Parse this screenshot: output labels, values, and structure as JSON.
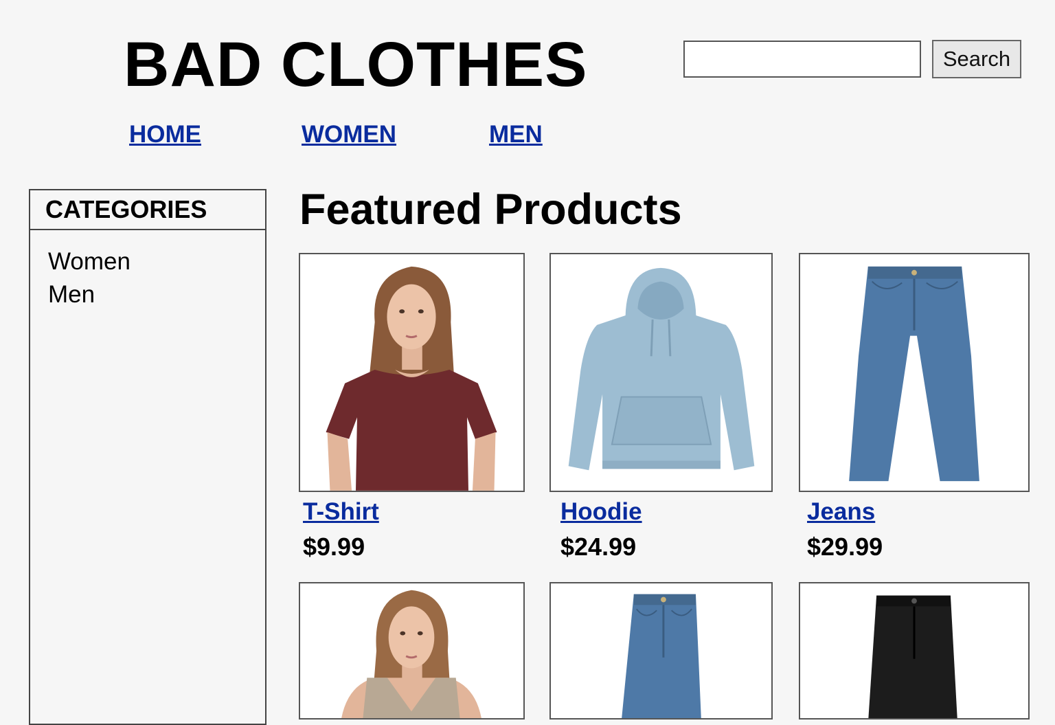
{
  "header": {
    "site_title": "BAD CLOTHES",
    "search_value": "",
    "search_button": "Search"
  },
  "nav": {
    "items": [
      {
        "label": "HOME"
      },
      {
        "label": "WOMEN"
      },
      {
        "label": "MEN"
      }
    ]
  },
  "sidebar": {
    "heading": "CATEGORIES",
    "items": [
      {
        "label": "Women"
      },
      {
        "label": "Men"
      }
    ]
  },
  "main": {
    "title": "Featured Products",
    "products": [
      {
        "name": "T-Shirt",
        "price": "$9.99",
        "image": "woman-burgundy-tshirt-photo"
      },
      {
        "name": "Hoodie",
        "price": "$24.99",
        "image": "light-blue-hoodie-photo"
      },
      {
        "name": "Jeans",
        "price": "$29.99",
        "image": "blue-jeans-photo"
      },
      {
        "name": "",
        "price": "",
        "image": "woman-tank-top-photo"
      },
      {
        "name": "",
        "price": "",
        "image": "blue-high-waist-jeans-photo"
      },
      {
        "name": "",
        "price": "",
        "image": "black-jeans-photo"
      }
    ]
  },
  "colors": {
    "link": "#0a2c9e",
    "tshirt": "#6e2a2d",
    "hoodie": "#9dbdd2",
    "denim": "#4e79a7",
    "black_denim": "#1c1c1c",
    "tank": "#b8a894"
  }
}
